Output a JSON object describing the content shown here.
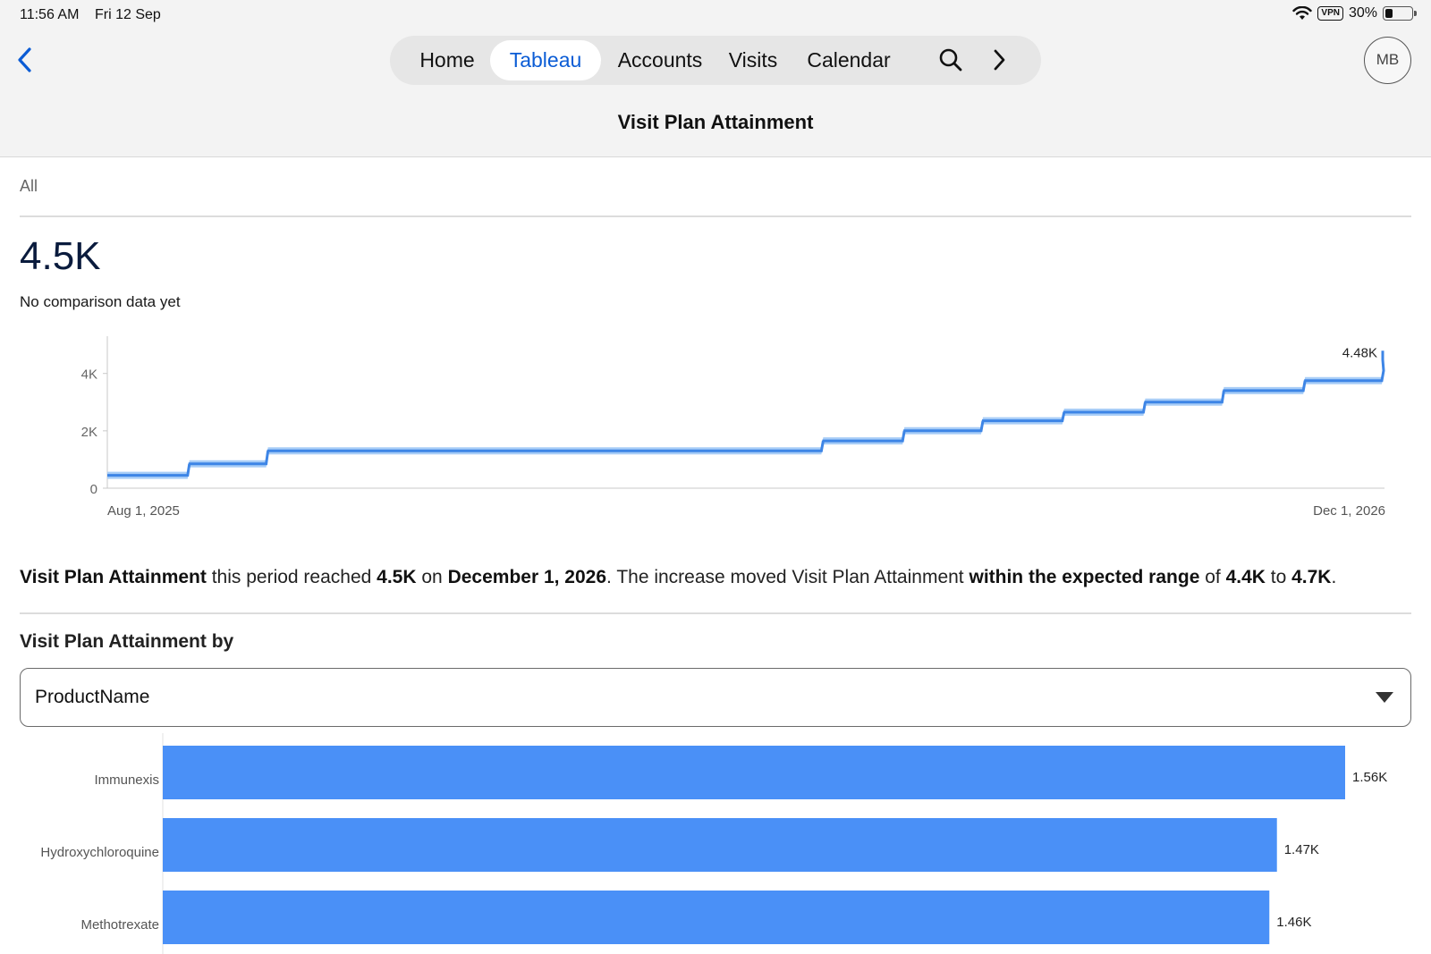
{
  "status_bar": {
    "time": "11:56 AM",
    "date": "Fri 12 Sep",
    "vpn": "VPN",
    "battery": "30%",
    "battery_level": 0.3
  },
  "nav": {
    "back_icon": "chevron-left-icon",
    "tabs": [
      {
        "label": "Home",
        "active": false
      },
      {
        "label": "Tableau",
        "active": true
      },
      {
        "label": "Accounts",
        "active": false
      },
      {
        "label": "Visits",
        "active": false
      },
      {
        "label": "Calendar",
        "active": false
      }
    ],
    "search_icon": "search-icon",
    "more_icon": "chevron-right-icon",
    "avatar_initials": "MB"
  },
  "page": {
    "title": "Visit Plan Attainment",
    "filter": "All",
    "kpi_value": "4.5K",
    "kpi_subtitle": "No comparison data yet"
  },
  "insight": {
    "parts": [
      {
        "text": "Visit Plan Attainment",
        "bold": true
      },
      {
        "text": " this period reached ",
        "bold": false
      },
      {
        "text": "4.5K",
        "bold": true
      },
      {
        "text": " on ",
        "bold": false
      },
      {
        "text": "December 1, 2026",
        "bold": true
      },
      {
        "text": ". The increase moved Visit Plan Attainment ",
        "bold": false
      },
      {
        "text": "within the expected range",
        "bold": true
      },
      {
        "text": " of ",
        "bold": false
      },
      {
        "text": "4.4K",
        "bold": true
      },
      {
        "text": " to ",
        "bold": false
      },
      {
        "text": "4.7K",
        "bold": true
      },
      {
        "text": ".",
        "bold": false
      }
    ]
  },
  "breakdown": {
    "title": "Visit Plan Attainment by",
    "dimension": "ProductName"
  },
  "colors": {
    "accent": "#0b5cd5",
    "line": "#3d85e6",
    "band": "#a8cdf7",
    "bar": "#4a90f7",
    "kpi": "#0a1b3d"
  },
  "chart_data": [
    {
      "type": "line",
      "x": [
        "2025-08-01",
        "2025-09-01",
        "2025-10-01",
        "2026-06-01",
        "2026-07-01",
        "2026-08-01",
        "2026-09-01",
        "2026-10-01",
        "2026-11-01",
        "2026-12-01"
      ],
      "values": [
        450,
        850,
        1300,
        1650,
        2000,
        2350,
        2650,
        3000,
        3400,
        3750,
        4100,
        4480
      ],
      "step_dates": [
        "2025-08-01",
        "2025-09-01",
        "2025-10-01",
        "2026-05-01",
        "2026-06-01",
        "2026-07-01",
        "2026-08-01",
        "2026-09-01",
        "2026-10-01",
        "2026-11-01",
        "2026-12-01"
      ],
      "step_values": [
        450,
        850,
        1300,
        1650,
        2000,
        2350,
        2650,
        3000,
        3400,
        3750,
        4100,
        4480
      ],
      "x_start_label": "Aug 1, 2025",
      "x_end_label": "Dec 1, 2026",
      "y_ticks": [
        "0",
        "2K",
        "4K"
      ],
      "y_tick_values": [
        0,
        2000,
        4000
      ],
      "ylim": [
        0,
        5300
      ],
      "end_label": "4.48K",
      "expected_range": [
        4400,
        4700
      ],
      "grid": false
    },
    {
      "type": "bar",
      "orientation": "horizontal",
      "categories": [
        "Immunexis",
        "Hydroxychloroquine",
        "Methotrexate"
      ],
      "values": [
        1560,
        1470,
        1460
      ],
      "value_labels": [
        "1.56K",
        "1.47K",
        "1.46K"
      ]
    }
  ]
}
